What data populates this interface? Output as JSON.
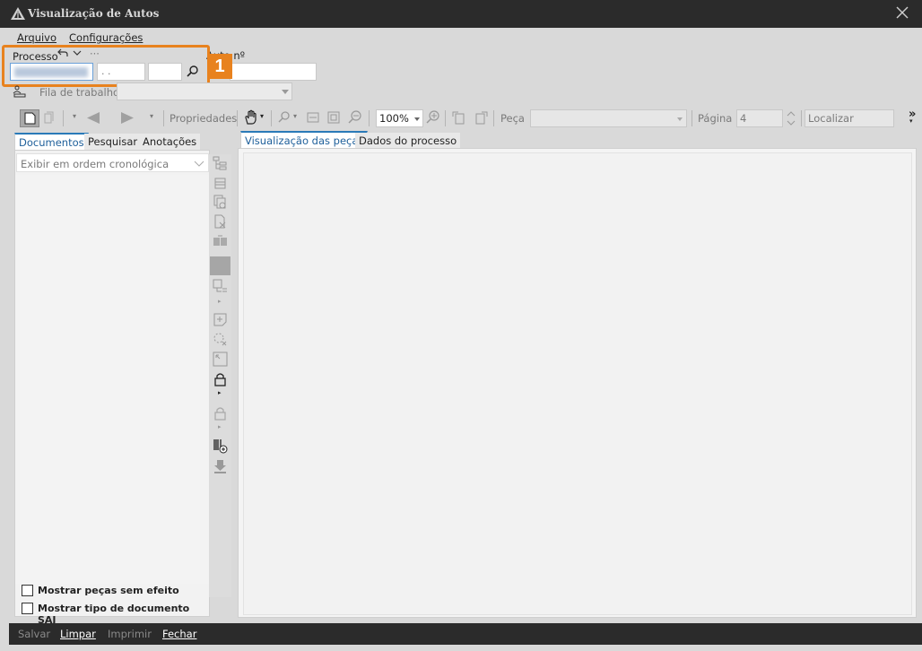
{
  "window": {
    "title": "Visualização de Autos"
  },
  "menu": {
    "arquivo": "Arquivo",
    "configuracoes": "Configurações"
  },
  "processo": {
    "label": "Processo",
    "part2_value": ". .",
    "badge": "1",
    "auto_label": "Auto nº"
  },
  "fila": {
    "label": "Fila de trabalho"
  },
  "toolbar": {
    "propriedades": "Propriedades",
    "zoom": "100%",
    "peca_label": "Peça",
    "pagina_label": "Página",
    "pagina_value": "4",
    "localizar_placeholder": "Localizar",
    "overflow": "»"
  },
  "left_tabs": {
    "documentos": "Documentos",
    "pesquisar": "Pesquisar",
    "anotacoes": "Anotações"
  },
  "order_select": {
    "value": "Exibir em ordem cronológica"
  },
  "checkboxes": {
    "sem_efeito": "Mostrar peças sem efeito",
    "tipo_saj": "Mostrar tipo de documento SAJ"
  },
  "right_tabs": {
    "visualizacao": "Visualização das peças",
    "dados": "Dados do processo"
  },
  "statusbar": {
    "salvar": "Salvar",
    "limpar": "Limpar",
    "imprimir": "Imprimir",
    "fechar": "Fechar"
  }
}
